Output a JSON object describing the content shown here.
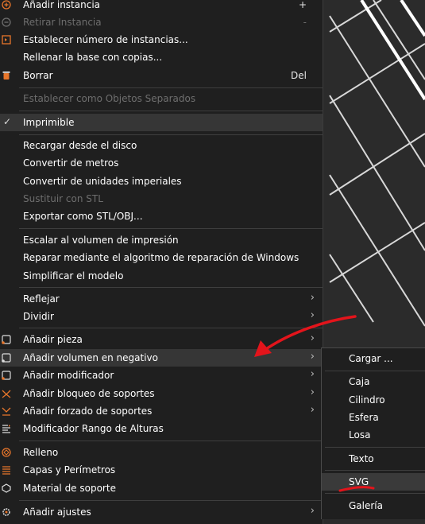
{
  "menu": {
    "items": [
      {
        "label": "Añadir instancia",
        "shortcut": "+"
      },
      {
        "label": "Retirar Instancia",
        "shortcut": "-"
      },
      {
        "label": "Establecer número de instancias..."
      },
      {
        "label": "Rellenar la base con copias..."
      },
      {
        "label": "Borrar",
        "shortcut": "Del"
      },
      {
        "label": "Establecer como Objetos Separados"
      },
      {
        "label": "Imprimible"
      },
      {
        "label": "Recargar desde el disco"
      },
      {
        "label": "Convertir de metros"
      },
      {
        "label": "Convertir de unidades imperiales"
      },
      {
        "label": "Sustituir con STL"
      },
      {
        "label": "Exportar como STL/OBJ..."
      },
      {
        "label": "Escalar al volumen de impresión"
      },
      {
        "label": "Reparar mediante el algoritmo de reparación de Windows"
      },
      {
        "label": "Simplificar el modelo"
      },
      {
        "label": "Reflejar"
      },
      {
        "label": "Dividir"
      },
      {
        "label": "Añadir pieza"
      },
      {
        "label": "Añadir volumen en negativo"
      },
      {
        "label": "Añadir modificador"
      },
      {
        "label": "Añadir bloqueo de soportes"
      },
      {
        "label": "Añadir forzado de soportes"
      },
      {
        "label": "Modificador Rango de Alturas"
      },
      {
        "label": "Relleno"
      },
      {
        "label": "Capas y Perímetros"
      },
      {
        "label": "Material de soporte"
      },
      {
        "label": "Añadir ajustes"
      }
    ],
    "submenu_arrow": "›",
    "check_mark": "✓"
  },
  "submenu": {
    "items": [
      {
        "label": "Cargar ..."
      },
      {
        "label": "Caja"
      },
      {
        "label": "Cilindro"
      },
      {
        "label": "Esfera"
      },
      {
        "label": "Losa"
      },
      {
        "label": "Texto"
      },
      {
        "label": "SVG"
      },
      {
        "label": "Galería"
      }
    ]
  },
  "colors": {
    "accent_orange": "#e8762b",
    "annotation_red": "#e3141b",
    "menu_bg": "#1f1f1f",
    "viewport_bg": "#2b2b2b"
  },
  "icons": {
    "add_instance": "plus-circle-icon",
    "remove_instance": "minus-circle-icon",
    "set_instances": "instance-count-icon",
    "delete": "trash-icon",
    "add_part": "add-part-icon",
    "add_negative_volume": "add-negative-volume-icon",
    "add_modifier": "add-modifier-icon",
    "support_blocker": "support-blocker-icon",
    "support_enforcer": "support-enforcer-icon",
    "height_range": "height-range-icon",
    "infill": "infill-icon",
    "layers": "layers-perimeters-icon",
    "support_material": "support-material-icon",
    "settings": "gear-icon"
  }
}
